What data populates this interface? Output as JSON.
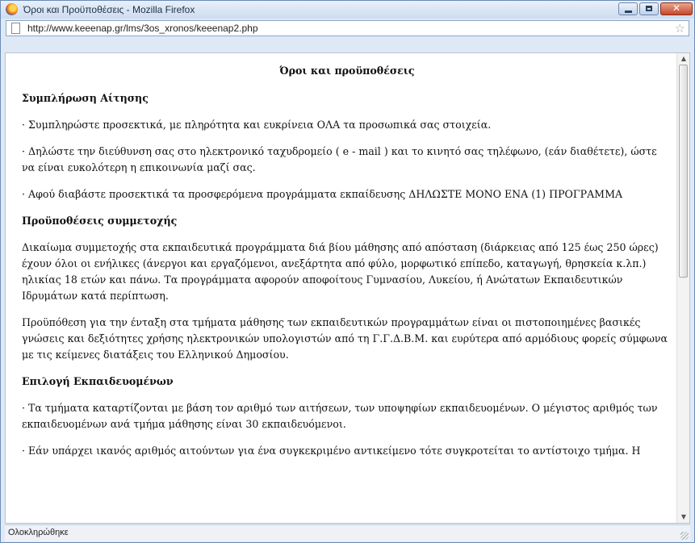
{
  "window": {
    "title": "Όροι και Προϋποθέσεις - Mozilla Firefox",
    "close_glyph": "✕"
  },
  "address_bar": {
    "url": "http://www.keeenap.gr/lms/3os_xronos/keeenap2.php",
    "star_glyph": "☆"
  },
  "document": {
    "title": "Όροι και προϋποθέσεις",
    "sections": [
      {
        "heading": "Συμπλήρωση Αίτησης",
        "paragraphs": [
          "· Συμπληρώστε προσεκτικά, με πληρότητα και ευκρίνεια ΟΛΑ τα προσωπικά σας στοιχεία.",
          "· Δηλώστε την διεύθυνση σας στο ηλεκτρονικό ταχυδρομείο ( e - mail ) και το κινητό σας τηλέφωνο, (εάν διαθέτετε), ώστε να είναι ευκολότερη η επικοινωνία μαζί σας.",
          "· Αφού διαβάστε προσεκτικά τα προσφερόμενα προγράμματα εκπαίδευσης ΔΗΛΩΣΤΕ ΜΟΝΟ ΕΝΑ (1) ΠΡΟΓΡΑΜΜΑ"
        ]
      },
      {
        "heading": "Προϋποθέσεις συμμετοχής",
        "paragraphs": [
          "Δικαίωμα συμμετοχής στα εκπαιδευτικά προγράμματα διά βίου μάθησης από απόσταση (διάρκειας από 125 έως 250 ώρες) έχουν όλοι οι ενήλικες (άνεργοι και εργαζόμενοι, ανεξάρτητα από φύλο, μορφωτικό επίπεδο, καταγωγή, θρησκεία κ.λπ.) ηλικίας 18 ετών και πάνω. Τα προγράμματα αφορούν αποφοίτους Γυμνασίου, Λυκείου, ή Ανώτατων Εκπαιδευτικών Ιδρυμάτων κατά περίπτωση.",
          "Προϋπόθεση για την ένταξη στα τμήματα μάθησης των εκπαιδευτικών προγραμμάτων είναι οι πιστοποιημένες βασικές γνώσεις και δεξιότητες χρήσης ηλεκτρονικών υπολογιστών από τη Γ.Γ.Δ.Β.Μ. και ευρύτερα από αρμόδιους φορείς σύμφωνα με τις κείμενες διατάξεις του Ελληνικού Δημοσίου."
        ]
      },
      {
        "heading": "Επιλογή Εκπαιδευομένων",
        "paragraphs": [
          "· Τα τμήματα καταρτίζονται με βάση τον αριθμό των αιτήσεων, των υποψηφίων εκπαιδευομένων. Ο μέγιστος αριθμός των εκπαιδευομένων ανά τμήμα μάθησης είναι 30 εκπαιδευόμενοι.",
          "· Εάν υπάρχει ικανός αριθμός αιτούντων για ένα συγκεκριμένο αντικείμενο τότε συγκροτείται το αντίστοιχο τμήμα. Η"
        ]
      }
    ]
  },
  "status_bar": {
    "text": "Ολοκληρώθηκε"
  },
  "scrollbar": {
    "up_glyph": "▲",
    "down_glyph": "▼"
  }
}
